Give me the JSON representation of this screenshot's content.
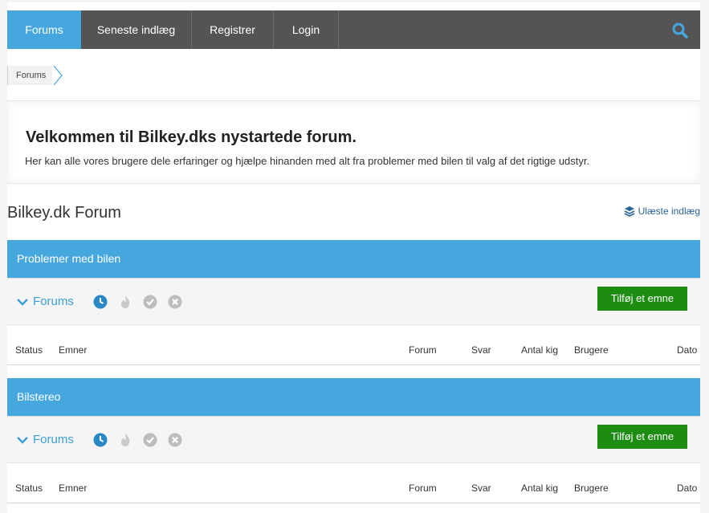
{
  "nav": {
    "items": [
      "Forums",
      "Seneste indlæg",
      "Registrer",
      "Login"
    ],
    "search_icon": "search-icon",
    "accent": "#45a7de"
  },
  "breadcrumb": [
    "Forums"
  ],
  "welcome": {
    "title": "Velkommen til Bilkey.dks nystartede forum.",
    "text": "Her kan alle vores brugere dele erfaringer og hjælpe hinanden med alt fra problemer med bilen til valg af det rigtige udstyr."
  },
  "forum": {
    "title": "Bilkey.dk Forum",
    "unread_label": "Ulæste indlæg"
  },
  "sections": [
    {
      "title": "Problemer med bilen",
      "toolbar_label": "Forums",
      "add_button": "Tilføj et emne",
      "columns": [
        "Status",
        "Emner",
        "Forum",
        "Svar",
        "Antal kig",
        "Brugere",
        "Dato"
      ]
    },
    {
      "title": "Bilstereo",
      "toolbar_label": "Forums",
      "add_button": "Tilføj et emne",
      "columns": [
        "Status",
        "Emner",
        "Forum",
        "Svar",
        "Antal kig",
        "Brugere",
        "Dato"
      ]
    }
  ],
  "colors": {
    "nav_bg": "#545454",
    "section_bg": "#45a7de",
    "button_green": "#1d8c12"
  }
}
